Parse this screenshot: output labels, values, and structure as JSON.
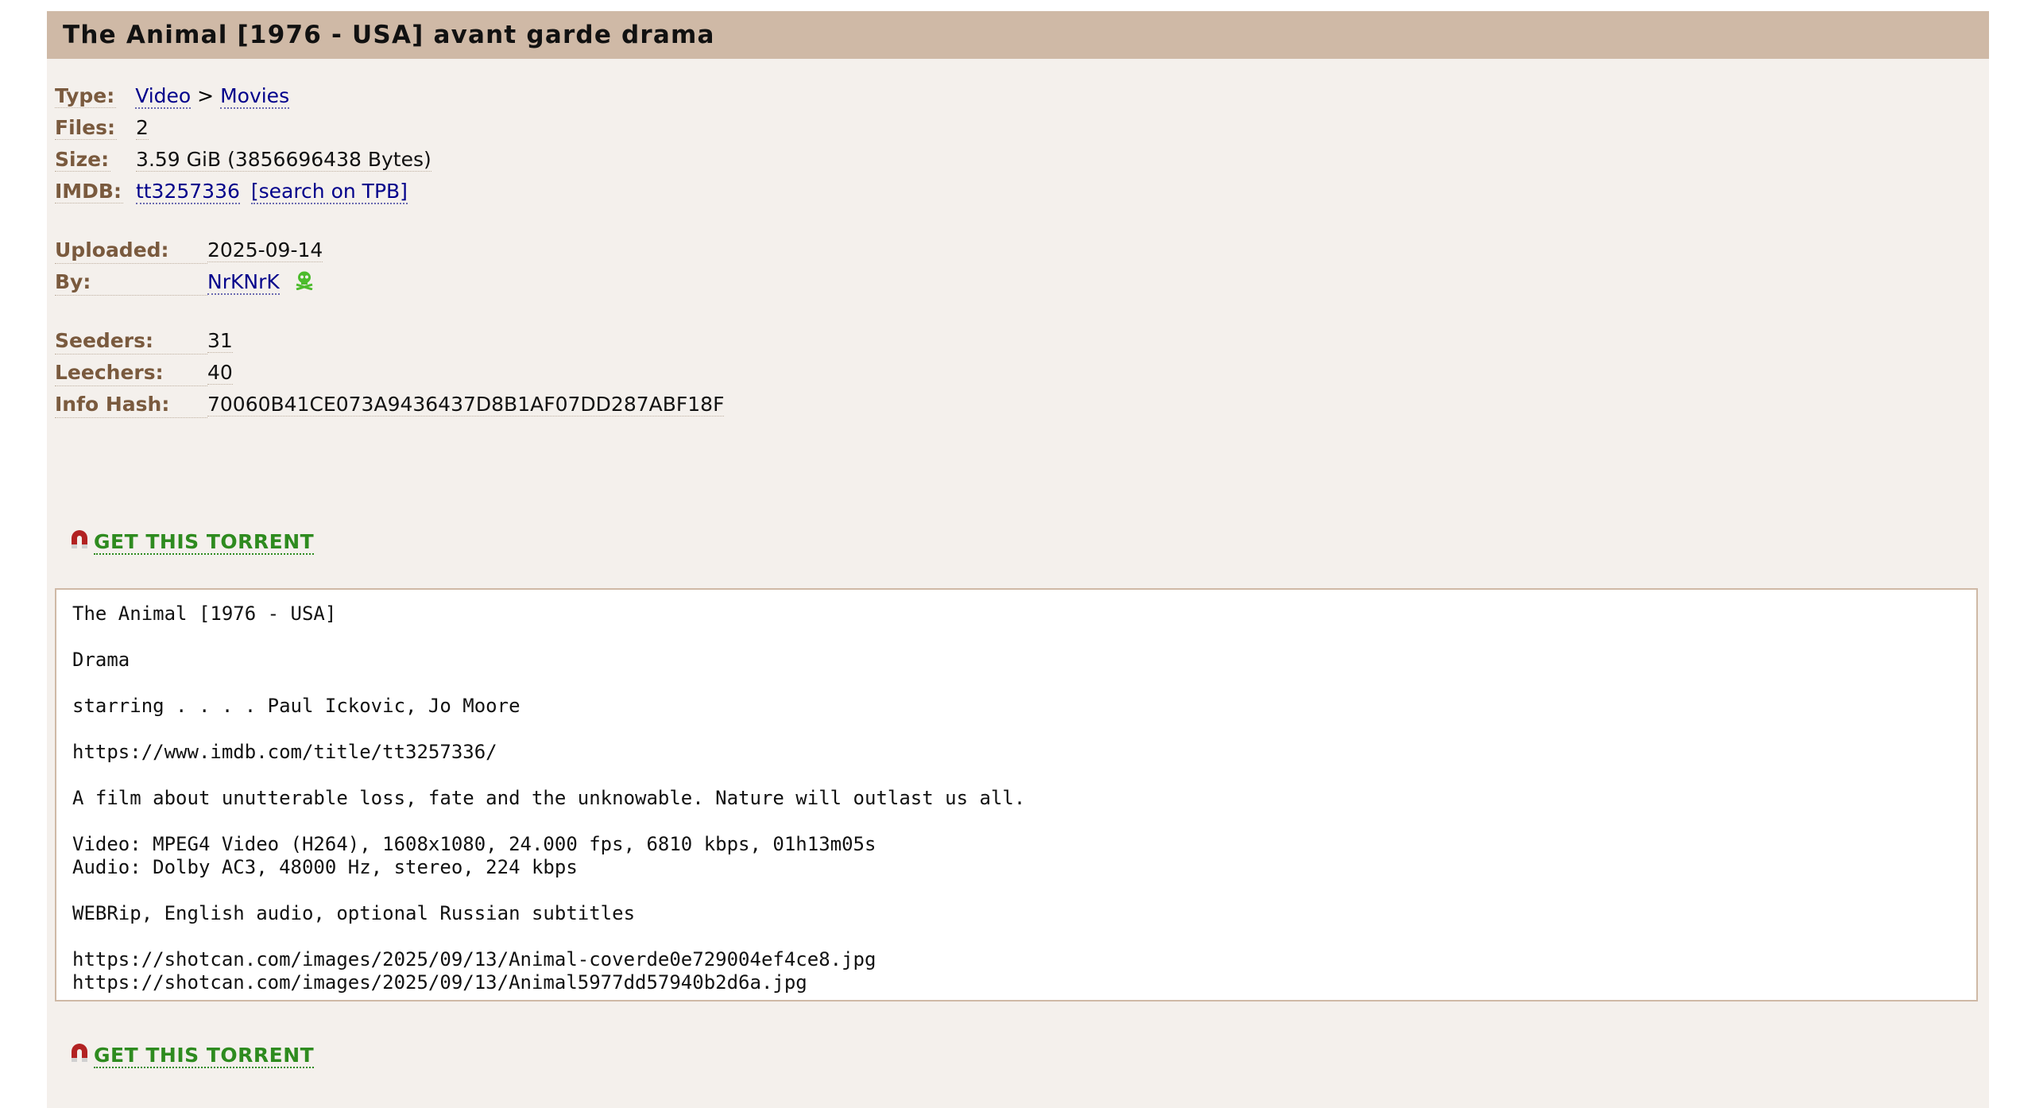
{
  "title": "The Animal [1976 - USA] avant garde drama",
  "details": {
    "type_label": "Type:",
    "type_link1": "Video",
    "type_sep": " > ",
    "type_link2": "Movies",
    "files_label": "Files:",
    "files_value": "2",
    "size_label": "Size:",
    "size_value": "3.59 GiB (3856696438 Bytes)",
    "imdb_label": "IMDB:",
    "imdb_link": "tt3257336",
    "imdb_search": "[search on TPB]",
    "uploaded_label": "Uploaded:",
    "uploaded_value": "2025-09-14",
    "by_label": "By:",
    "by_value": "NrKNrK",
    "seeders_label": "Seeders:",
    "seeders_value": "31",
    "leechers_label": "Leechers:",
    "leechers_value": "40",
    "hash_label": "Info Hash:",
    "hash_value": "70060B41CE073A9436437D8B1AF07DD287ABF18F"
  },
  "download": {
    "label": "GET THIS TORRENT",
    "icon": "magnet-icon",
    "color": "#2e8b1f"
  },
  "description": {
    "line1": "The Animal [1976 - USA]",
    "line2": "Drama",
    "line3": "starring . . . . Paul Ickovic, Jo Moore",
    "line4": "https://www.imdb.com/title/tt3257336/",
    "line5": "A film about unutterable loss, fate and the unknowable. Nature will outlast us all.",
    "line6": "Video: MPEG4 Video (H264), 1608x1080, 24.000 fps, 6810 kbps, 01h13m05s",
    "line7": "Audio: Dolby AC3, 48000 Hz, stereo, 224 kbps",
    "line8": "WEBRip, English audio, optional Russian subtitles",
    "line9": "https://shotcan.com/images/2025/09/13/Animal-coverde0e729004ef4ce8.jpg",
    "line10": "https://shotcan.com/images/2025/09/13/Animal5977dd57940b2d6a.jpg"
  },
  "colors": {
    "header_bg": "#cfb9a6",
    "page_bg": "#f4f0ec",
    "label": "#7a5a3e",
    "link": "#00008b",
    "vip_icon": "#4cbb2c"
  },
  "icons": {
    "uploader_status": "vip-skull-icon"
  }
}
